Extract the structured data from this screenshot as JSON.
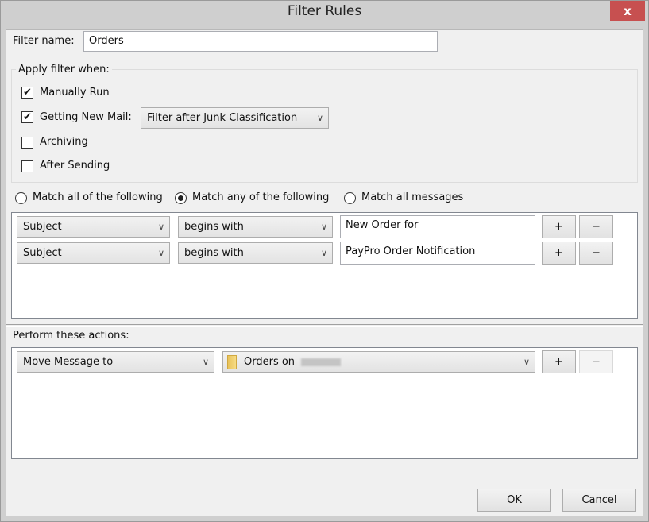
{
  "title": "Filter Rules",
  "close_label": "x",
  "filter_name_label": "Filter name:",
  "filter_name_value": "Orders",
  "apply_group_label": "Apply filter when:",
  "apply": {
    "manual": {
      "label": "Manually Run",
      "checked": true
    },
    "newmail": {
      "label": "Getting New Mail:",
      "checked": true
    },
    "newmail_option": "Filter after Junk Classification",
    "archiving": {
      "label": "Archiving",
      "checked": false
    },
    "after_sending": {
      "label": "After Sending",
      "checked": false
    }
  },
  "match": {
    "all": "Match all of the following",
    "any": "Match any of the following",
    "messages": "Match all messages",
    "selected": "any"
  },
  "rules": [
    {
      "field": "Subject",
      "op": "begins with",
      "value": "New Order for"
    },
    {
      "field": "Subject",
      "op": "begins with",
      "value": "PayPro Order Notification"
    }
  ],
  "actions_label": "Perform these actions:",
  "action": {
    "type": "Move Message to",
    "target": "Orders on"
  },
  "plus": "+",
  "minus": "−",
  "ok": "OK",
  "cancel": "Cancel"
}
